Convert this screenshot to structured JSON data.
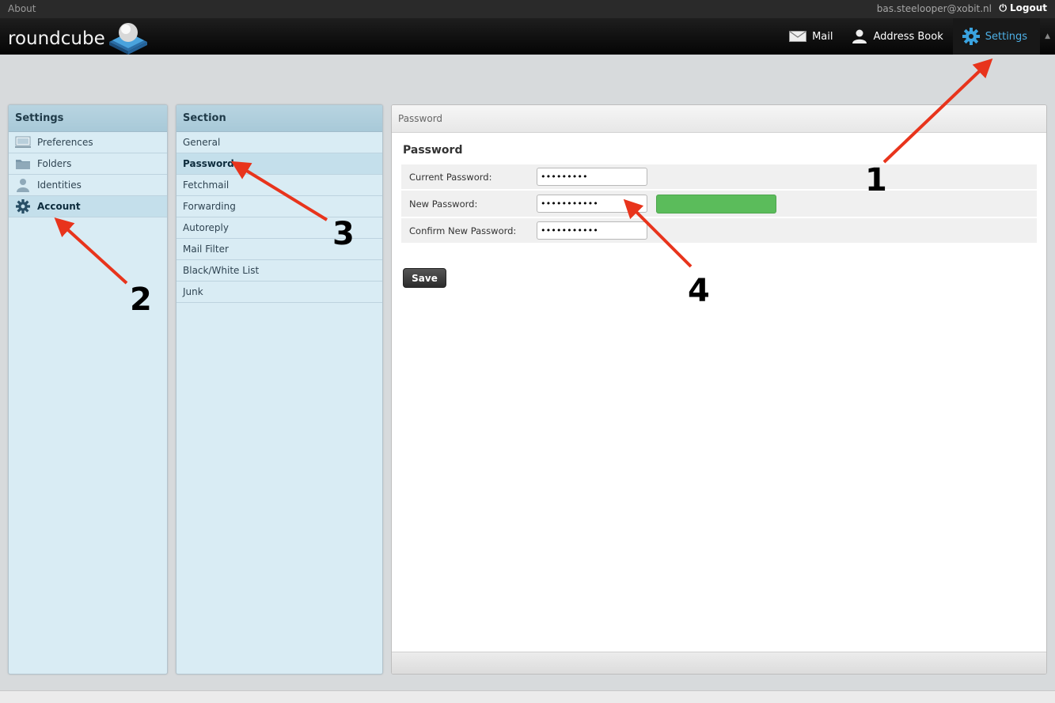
{
  "topline": {
    "about": "About",
    "user": "bas.steelooper@xobit.nl",
    "logout": "Logout"
  },
  "header": {
    "logo_text": "roundcube",
    "nav": [
      {
        "label": "Mail",
        "icon": "mail-icon"
      },
      {
        "label": "Address Book",
        "icon": "contact-icon"
      },
      {
        "label": "Settings",
        "icon": "gear-icon",
        "selected": true
      }
    ],
    "accent_color": "#4db0e6"
  },
  "settings_panel": {
    "title": "Settings",
    "items": [
      {
        "label": "Preferences",
        "icon": "computer-icon"
      },
      {
        "label": "Folders",
        "icon": "folder-icon"
      },
      {
        "label": "Identities",
        "icon": "person-icon"
      },
      {
        "label": "Account",
        "icon": "gear-icon",
        "selected": true
      }
    ]
  },
  "section_panel": {
    "title": "Section",
    "items": [
      {
        "label": "General"
      },
      {
        "label": "Password",
        "selected": true
      },
      {
        "label": "Fetchmail"
      },
      {
        "label": "Forwarding"
      },
      {
        "label": "Autoreply"
      },
      {
        "label": "Mail Filter"
      },
      {
        "label": "Black/White List"
      },
      {
        "label": "Junk"
      }
    ]
  },
  "content": {
    "header": "Password",
    "title": "Password",
    "fields": [
      {
        "label": "Current Password:",
        "value": "•••••••••"
      },
      {
        "label": "New Password:",
        "value": "•••••••••••"
      },
      {
        "label": "Confirm New Password:",
        "value": "•••••••••••"
      }
    ],
    "strength_color": "#5bbc5b",
    "save_label": "Save"
  },
  "annotations": {
    "color": "#e8341c",
    "labels": [
      "1",
      "2",
      "3",
      "4"
    ]
  }
}
